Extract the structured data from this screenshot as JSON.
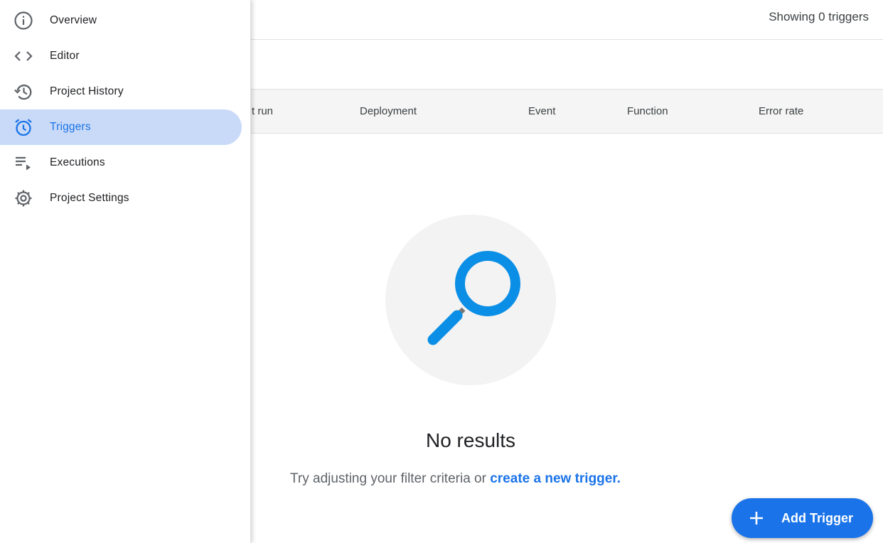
{
  "header": {
    "showing_text": "Showing 0 triggers"
  },
  "table": {
    "columns": [
      "t run",
      "Deployment",
      "Event",
      "Function",
      "Error rate"
    ]
  },
  "empty_state": {
    "icon": "magnifier-icon",
    "title": "No results",
    "hint_prefix": "Try adjusting your filter criteria or",
    "hint_link": "create a new trigger."
  },
  "fab": {
    "icon": "plus-icon",
    "label": "Add Trigger"
  },
  "sidebar": {
    "items": [
      {
        "label": "Overview",
        "icon": "info-icon",
        "active": false
      },
      {
        "label": "Editor",
        "icon": "code-icon",
        "active": false
      },
      {
        "label": "Project History",
        "icon": "history-icon",
        "active": false
      },
      {
        "label": "Triggers",
        "icon": "alarm-icon",
        "active": true
      },
      {
        "label": "Executions",
        "icon": "executions-icon",
        "active": false
      },
      {
        "label": "Project Settings",
        "icon": "gear-icon",
        "active": false
      }
    ]
  },
  "colors": {
    "accent": "#1a73e8",
    "active_bg": "#c9daf8",
    "magnifier": "#0b8fe6"
  }
}
